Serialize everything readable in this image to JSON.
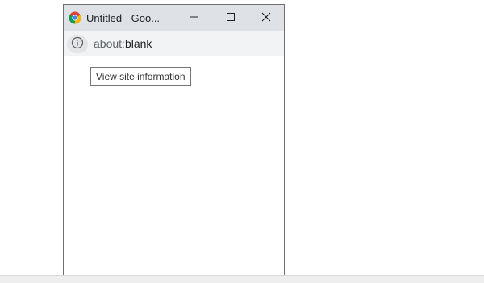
{
  "window": {
    "title": "Untitled - Goo...",
    "controls": {
      "minimize_icon": "minimize-icon",
      "maximize_icon": "maximize-icon",
      "close_icon": "close-icon"
    }
  },
  "address_bar": {
    "site_info_icon": "info-icon",
    "url_scheme": "about:",
    "url_host": "blank"
  },
  "tooltip": {
    "text": "View site information"
  },
  "colors": {
    "titlebar": "#dee1e6",
    "address_bar": "#f1f3f4",
    "chip": "#e3e5e8",
    "window_border": "#6f6f6f"
  }
}
